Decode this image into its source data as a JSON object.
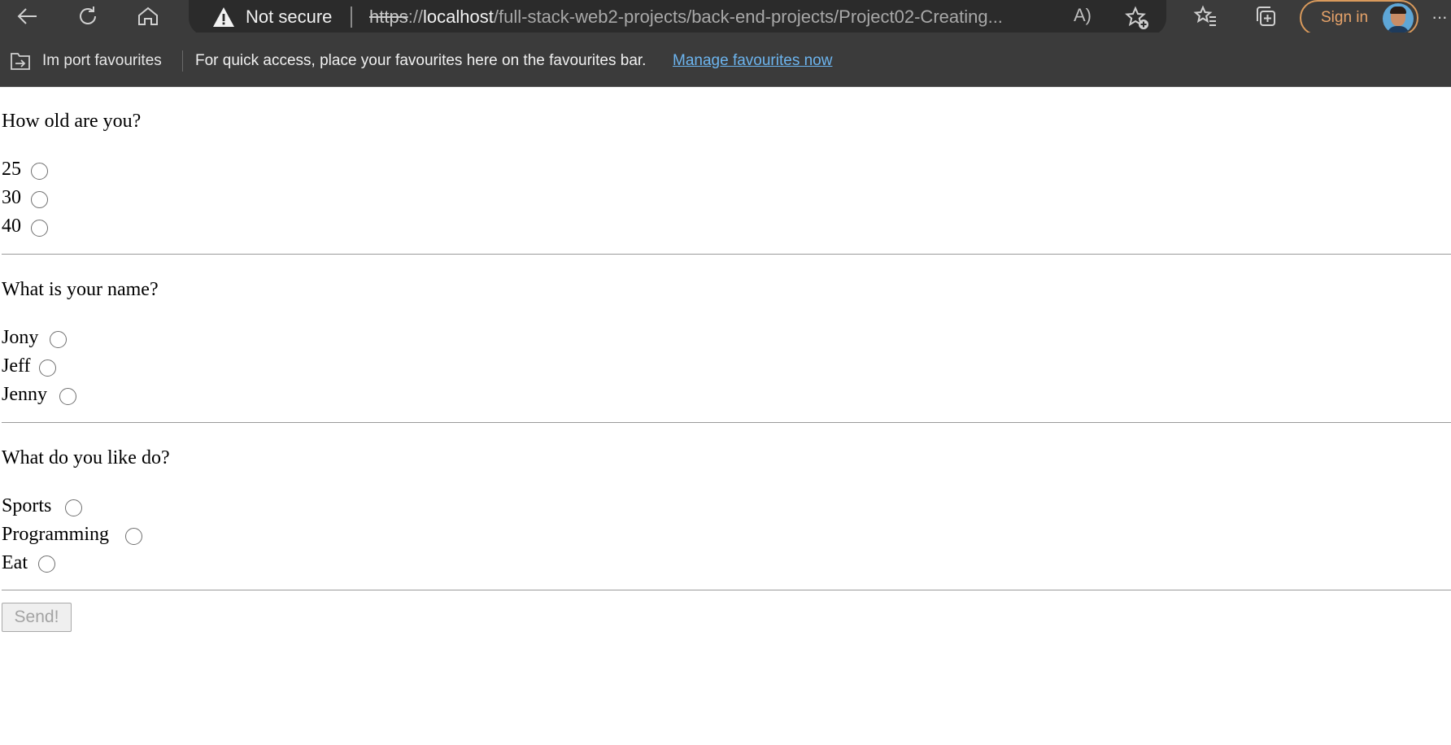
{
  "browser": {
    "security_label": "Not secure",
    "url_scheme": "https",
    "url_sep": "://",
    "url_host": "localhost",
    "url_path": "/full-stack-web2-projects/back-end-projects/Project02-Creating...",
    "read_aloud_glyph": "A)",
    "sign_in_label": "Sign in",
    "more_glyph": "···",
    "icons": [
      "back-icon",
      "refresh-icon",
      "home-icon",
      "warning-icon",
      "read-aloud-icon",
      "add-favourite-icon",
      "favourites-icon",
      "collections-icon",
      "more-icon"
    ]
  },
  "favourites_bar": {
    "import_label": "Im port favourites",
    "hint": "For quick access, place your favourites here on the favourites bar.",
    "manage_link": "Manage favourites now"
  },
  "form": {
    "questions": [
      {
        "text": "How old are you?",
        "options": [
          "25",
          "30",
          "40"
        ]
      },
      {
        "text": "What is your name?",
        "options": [
          "Jony",
          "Jeff",
          "Jenny"
        ]
      },
      {
        "text": "What do you like do?",
        "options": [
          "Sports",
          "Programming",
          "Eat"
        ]
      }
    ],
    "submit_label": "Send!"
  }
}
